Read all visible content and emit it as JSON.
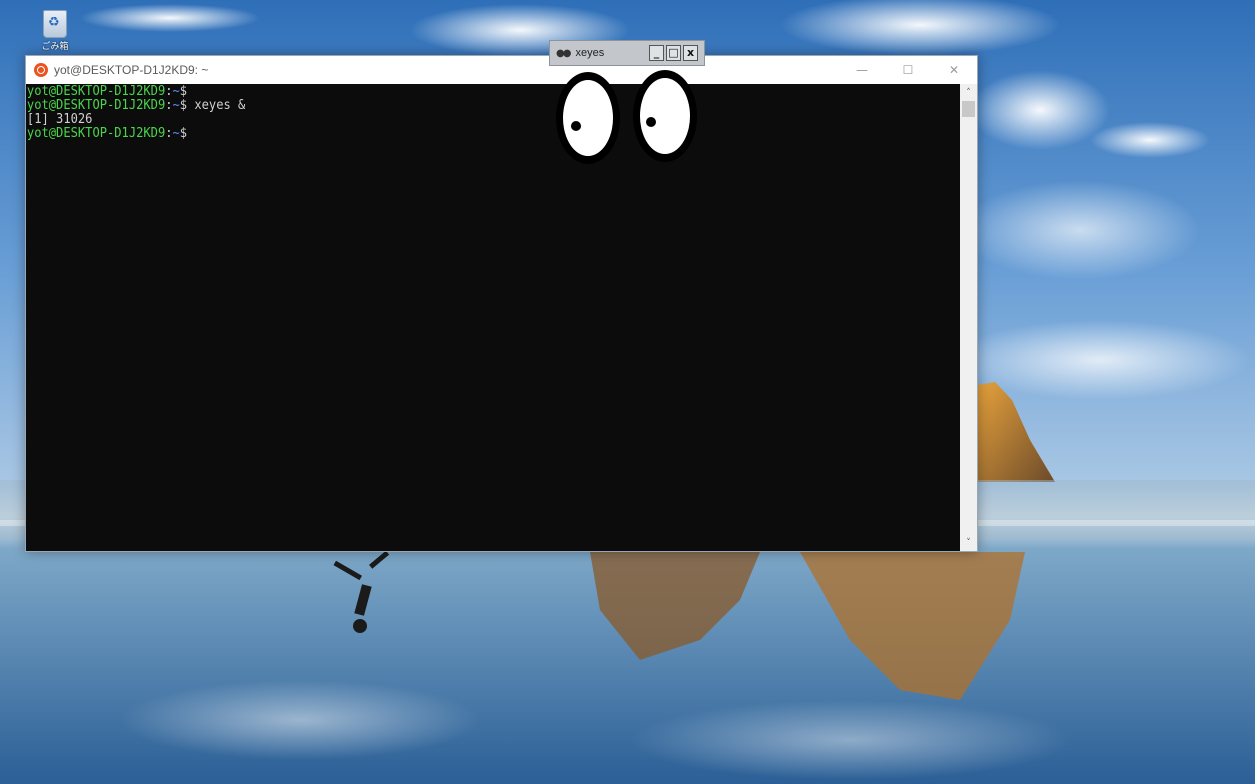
{
  "desktop": {
    "icon_label": "ごみ箱"
  },
  "terminal": {
    "title": "yot@DESKTOP-D1J2KD9: ~",
    "controls": {
      "minimize": "—",
      "maximize": "☐",
      "close": "✕"
    },
    "scroll_up": "˄",
    "scroll_down": "˅",
    "lines": [
      {
        "user": "yot@DESKTOP-D1J2KD9",
        "sep": ":",
        "path": "~",
        "prompt": "$",
        "cmd": ""
      },
      {
        "user": "yot@DESKTOP-D1J2KD9",
        "sep": ":",
        "path": "~",
        "prompt": "$",
        "cmd": " xeyes &"
      },
      {
        "output": "[1] 31026"
      },
      {
        "user": "yot@DESKTOP-D1J2KD9",
        "sep": ":",
        "path": "~",
        "prompt": "$",
        "cmd": ""
      }
    ]
  },
  "xeyes": {
    "title": "xeyes",
    "buttons": [
      "_",
      "□",
      "x"
    ],
    "eye_color": "#ffffff",
    "outline_color": "#000000"
  },
  "colors": {
    "user": "#4bd54b",
    "path": "#5b8cff",
    "terminal_bg": "#0c0c0c"
  }
}
